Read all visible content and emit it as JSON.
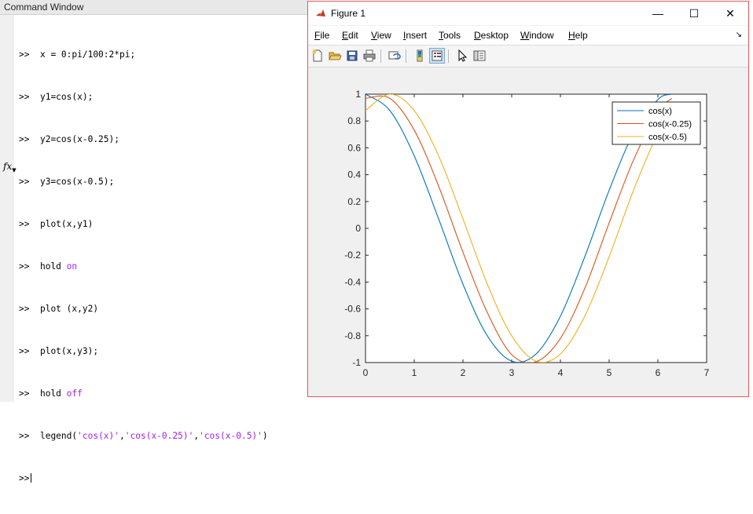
{
  "command_window": {
    "title": "Command Window",
    "prompt": ">>",
    "lines": [
      {
        "prompt": ">>",
        "code": "x = 0:pi/100:2*pi;"
      },
      {
        "prompt": ">>",
        "code": "y1=cos(x);"
      },
      {
        "prompt": ">>",
        "code": "y2=cos(x-0.25);"
      },
      {
        "prompt": ">>",
        "code": "y3=cos(x-0.5);"
      },
      {
        "prompt": ">>",
        "code": "plot(x,y1)"
      },
      {
        "prompt": ">>",
        "code": "hold ",
        "keyword": "on"
      },
      {
        "prompt": ">>",
        "code": "plot (x,y2)"
      },
      {
        "prompt": ">>",
        "code": "plot(x,y3);"
      },
      {
        "prompt": ">>",
        "code": "hold ",
        "keyword": "off"
      },
      {
        "prompt": ">>",
        "code": "legend(",
        "str1": "'cos(x)'",
        "comma1": ",",
        "str2": "'cos(x-0.25)'",
        "comma2": ",",
        "str3": "'cos(x-0.5)'",
        "close": ")"
      }
    ],
    "fx_label": "fx"
  },
  "figure": {
    "title": "Figure 1",
    "window_buttons": {
      "minimize": "—",
      "maximize": "☐",
      "close": "✕"
    },
    "menu": [
      {
        "label": "File",
        "u": "F",
        "rest": "ile"
      },
      {
        "label": "Edit",
        "u": "E",
        "rest": "dit"
      },
      {
        "label": "View",
        "u": "V",
        "rest": "iew"
      },
      {
        "label": "Insert",
        "u": "I",
        "rest": "nsert"
      },
      {
        "label": "Tools",
        "u": "T",
        "rest": "ools"
      },
      {
        "label": "Desktop",
        "u": "D",
        "rest": "esktop"
      },
      {
        "label": "Window",
        "u": "W",
        "rest": "indow"
      },
      {
        "label": "Help",
        "u": "H",
        "rest": "elp"
      }
    ],
    "toolbar": [
      "new-figure-icon",
      "open-file-icon",
      "save-icon",
      "print-icon",
      "link-plot-icon",
      "colorbar-icon",
      "legend-icon",
      "pointer-icon",
      "property-editor-icon"
    ]
  },
  "chart_data": {
    "type": "line",
    "title": "",
    "xlabel": "",
    "ylabel": "",
    "xlim": [
      0,
      7
    ],
    "ylim": [
      -1,
      1
    ],
    "x_ticks": [
      "0",
      "1",
      "2",
      "3",
      "4",
      "5",
      "6",
      "7"
    ],
    "y_ticks": [
      "-1",
      "-0.8",
      "-0.6",
      "-0.4",
      "-0.2",
      "0",
      "0.2",
      "0.4",
      "0.6",
      "0.8",
      "1"
    ],
    "x": [
      0,
      0.5,
      1.0,
      1.5,
      2.0,
      2.5,
      3.0,
      3.5,
      4.0,
      4.5,
      5.0,
      5.5,
      6.0,
      6.283
    ],
    "series": [
      {
        "name": "cos(x)",
        "color": "#0072BD",
        "values": [
          1.0,
          0.878,
          0.54,
          0.071,
          -0.416,
          -0.801,
          -0.99,
          -0.936,
          -0.654,
          -0.211,
          0.284,
          0.709,
          0.96,
          1.0
        ]
      },
      {
        "name": "cos(x-0.25)",
        "color": "#D95319",
        "values": [
          0.969,
          0.969,
          0.732,
          0.315,
          -0.178,
          -0.628,
          -0.941,
          -0.994,
          -0.82,
          -0.447,
          0.041,
          0.51,
          0.869,
          0.969
        ]
      },
      {
        "name": "cos(x-0.5)",
        "color": "#EDB120",
        "values": [
          0.878,
          1.0,
          0.878,
          0.54,
          0.071,
          -0.416,
          -0.801,
          -0.99,
          -0.936,
          -0.654,
          -0.211,
          0.284,
          0.709,
          0.878
        ]
      }
    ],
    "legend": {
      "placement": "top-right",
      "entries": [
        "cos(x)",
        "cos(x-0.25)",
        "cos(x-0.5)"
      ]
    },
    "grid": false
  }
}
